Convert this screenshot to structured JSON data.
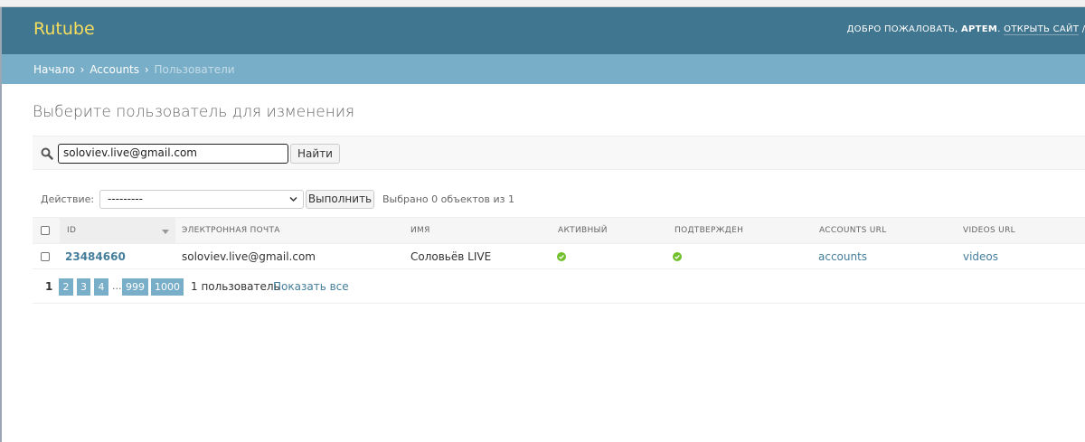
{
  "header": {
    "brand": "Rutube",
    "welcome": "ДОБРО ПОЖАЛОВАТЬ,",
    "username": "АРТЕМ",
    "view_site": "ОТКРЫТЬ САЙТ",
    "separator": " / Д"
  },
  "breadcrumbs": {
    "home": "Начало",
    "app": "Accounts",
    "current": "Пользователи"
  },
  "page": {
    "title": "Выберите пользователь для изменения"
  },
  "search": {
    "value": "soloviev.live@gmail.com",
    "button": "Найти",
    "icon": "search-icon"
  },
  "actions": {
    "label": "Действие:",
    "selected": "---------",
    "go_button": "Выполнить",
    "counter": "Выбрано 0 объектов из 1"
  },
  "table": {
    "columns": [
      "ID",
      "ЭЛЕКТРОННАЯ ПОЧТА",
      "ИМЯ",
      "АКТИВНЫЙ",
      "ПОДТВЕРЖДЕН",
      "ACCOUNTS URL",
      "VIDEOS URL"
    ],
    "rows": [
      {
        "id": "23484660",
        "email": "soloviev.live@gmail.com",
        "name": "Соловьёв LIVE",
        "active": true,
        "confirmed": true,
        "accounts_url": "accounts",
        "videos_url": "videos"
      }
    ]
  },
  "pagination": {
    "current": "1",
    "pages": [
      "2",
      "3",
      "4"
    ],
    "ellipsis": "...",
    "last_pages": [
      "999",
      "1000"
    ],
    "total": "1 пользователь",
    "show_all": "Показать все"
  },
  "colors": {
    "header_bg": "#417690",
    "breadcrumbs_bg": "#79aec8",
    "brand": "#f5dd5d",
    "link": "#447e9b",
    "ok_green": "#70bf2b"
  }
}
